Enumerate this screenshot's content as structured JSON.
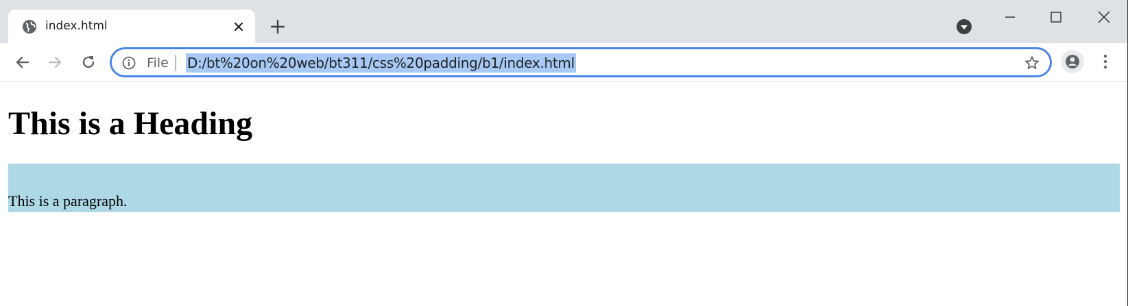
{
  "browser": {
    "tab": {
      "title": "index.html",
      "favicon": "globe-icon"
    },
    "toolbar": {
      "scheme_label": "File",
      "url": "D:/bt%20on%20web/bt311/css%20padding/b1/index.html",
      "url_selected": true
    },
    "icons": {
      "new_tab": "plus-icon",
      "tab_search": "chevron-down-circle-icon",
      "back": "arrow-left-icon",
      "forward": "arrow-right-icon",
      "reload": "reload-icon",
      "site_info": "info-icon",
      "bookmark": "star-icon",
      "profile": "avatar-icon",
      "menu": "vertical-dots-icon"
    },
    "colors": {
      "tabstrip_bg": "#dee1e6",
      "omnibox_focus": "#4b85e8",
      "url_selection": "#a9c9f5"
    }
  },
  "page": {
    "heading": "This is a Heading",
    "paragraph": "This is a paragraph.",
    "paragraph_bg": "#add8e6"
  }
}
